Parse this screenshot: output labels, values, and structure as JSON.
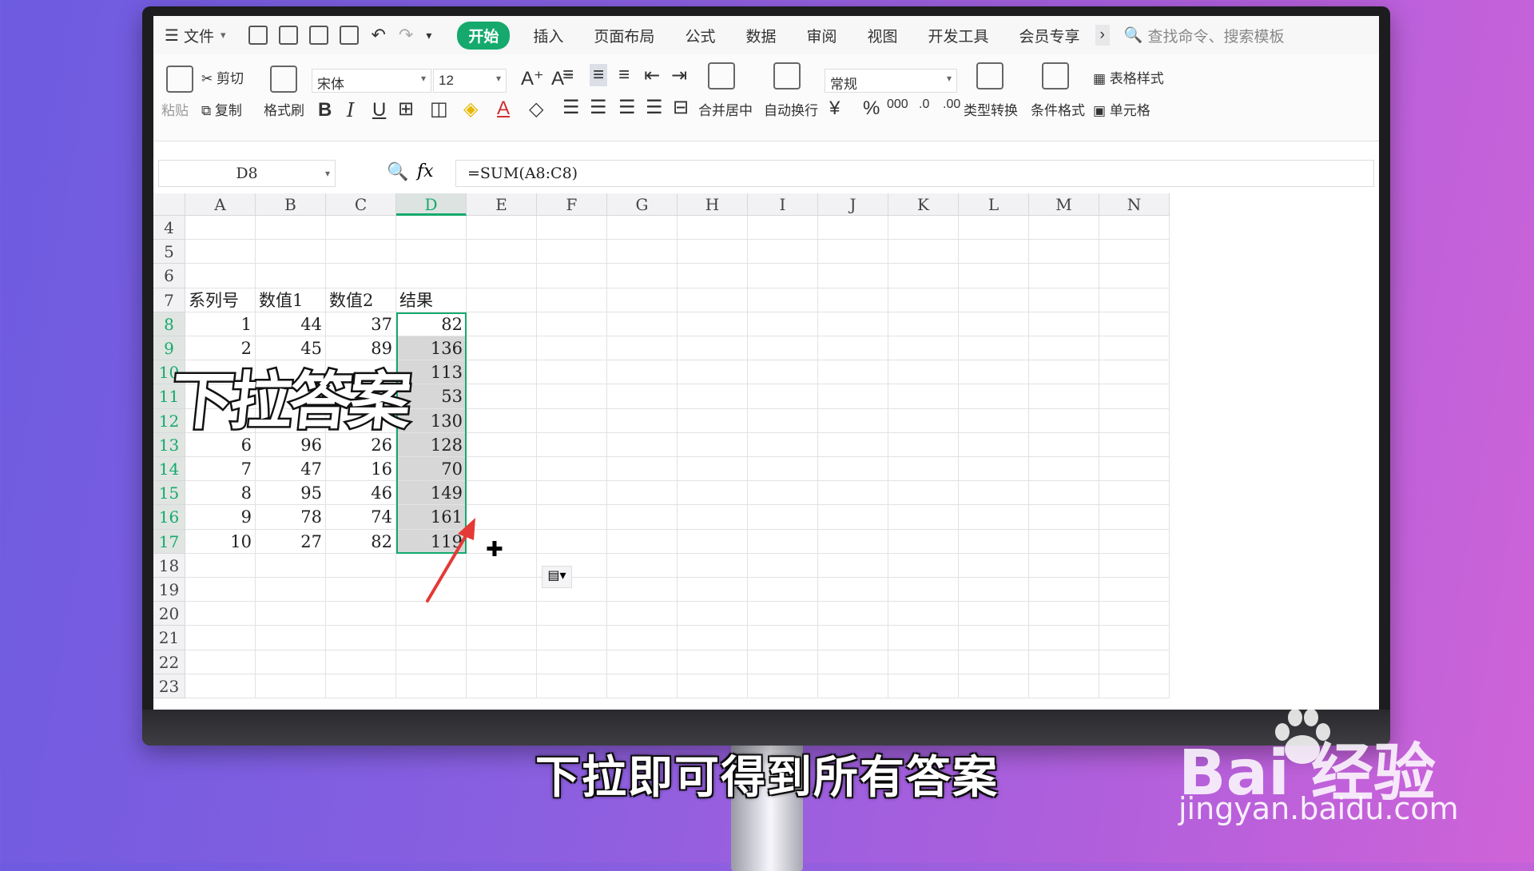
{
  "menubar": {
    "file_label": "文件",
    "tabs": [
      "开始",
      "插入",
      "页面布局",
      "公式",
      "数据",
      "审阅",
      "视图",
      "开发工具",
      "会员专享"
    ],
    "more": "›",
    "search_placeholder": "查找命令、搜索模板"
  },
  "ribbon": {
    "paste": "粘贴",
    "cut": "剪切",
    "copy": "复制",
    "format_painter": "格式刷",
    "font_name": "宋体",
    "font_size": "12",
    "merge_center": "合并居中",
    "wrap_text": "自动换行",
    "number_format": "常规",
    "type_convert": "类型转换",
    "cond_format": "条件格式",
    "table_style": "表格样式",
    "cell_style": "单元格",
    "bold": "B",
    "italic": "I",
    "underline": "U",
    "currency": "¥",
    "percent": "%"
  },
  "formula_bar": {
    "cell_ref": "D8",
    "fx": "fx",
    "formula": "=SUM(A8:C8)"
  },
  "columns": [
    "A",
    "B",
    "C",
    "D",
    "E",
    "F",
    "G",
    "H",
    "I",
    "J",
    "K",
    "L",
    "M",
    "N"
  ],
  "rows": [
    {
      "num": "4",
      "a": "",
      "b": "",
      "c": "",
      "d": ""
    },
    {
      "num": "5",
      "a": "",
      "b": "",
      "c": "",
      "d": ""
    },
    {
      "num": "6",
      "a": "",
      "b": "",
      "c": "",
      "d": ""
    },
    {
      "num": "7",
      "a": "系列号",
      "b": "数值1",
      "c": "数值2",
      "d": "结果"
    },
    {
      "num": "8",
      "a": "1",
      "b": "44",
      "c": "37",
      "d": "82"
    },
    {
      "num": "9",
      "a": "2",
      "b": "45",
      "c": "89",
      "d": "136"
    },
    {
      "num": "10",
      "a": "",
      "b": "",
      "c": "",
      "d": "113"
    },
    {
      "num": "11",
      "a": "",
      "b": "",
      "c": "",
      "d": "53"
    },
    {
      "num": "12",
      "a": "",
      "b": "",
      "c": "",
      "d": "130"
    },
    {
      "num": "13",
      "a": "6",
      "b": "96",
      "c": "26",
      "d": "128"
    },
    {
      "num": "14",
      "a": "7",
      "b": "47",
      "c": "16",
      "d": "70"
    },
    {
      "num": "15",
      "a": "8",
      "b": "95",
      "c": "46",
      "d": "149"
    },
    {
      "num": "16",
      "a": "9",
      "b": "78",
      "c": "74",
      "d": "161"
    },
    {
      "num": "17",
      "a": "10",
      "b": "27",
      "c": "82",
      "d": "119"
    },
    {
      "num": "18",
      "a": "",
      "b": "",
      "c": "",
      "d": ""
    },
    {
      "num": "19",
      "a": "",
      "b": "",
      "c": "",
      "d": ""
    },
    {
      "num": "20",
      "a": "",
      "b": "",
      "c": "",
      "d": ""
    },
    {
      "num": "21",
      "a": "",
      "b": "",
      "c": "",
      "d": ""
    },
    {
      "num": "22",
      "a": "",
      "b": "",
      "c": "",
      "d": ""
    },
    {
      "num": "23",
      "a": "",
      "b": "",
      "c": "",
      "d": ""
    }
  ],
  "overlay_text": "下拉答案",
  "caption": "下拉即可得到所有答案",
  "watermark": {
    "brand": "Bai  经验",
    "url": "jingyan.baidu.com"
  },
  "colors": {
    "accent": "#15a96e",
    "arrow": "#e53935"
  }
}
